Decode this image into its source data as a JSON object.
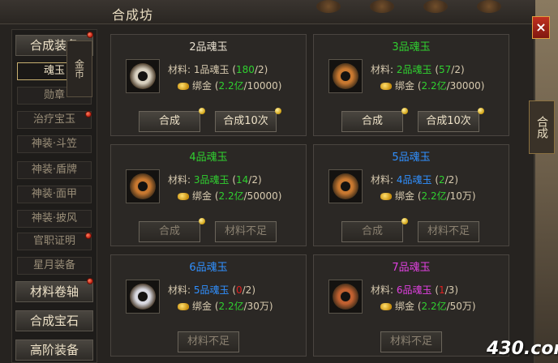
{
  "window": {
    "title": "合成坊"
  },
  "side_tabs": {
    "gold": "金币",
    "merge": "合成",
    "close": "×"
  },
  "sidebar": {
    "categories": [
      {
        "label": "合成装备"
      },
      {
        "label": "材料卷轴"
      },
      {
        "label": "合成宝石"
      },
      {
        "label": "高阶装备"
      }
    ],
    "items": [
      {
        "label": "魂玉"
      },
      {
        "label": "勋章"
      },
      {
        "label": "治疗宝玉"
      },
      {
        "label": "神装·斗笠"
      },
      {
        "label": "神装·盾牌"
      },
      {
        "label": "神装·面甲"
      },
      {
        "label": "神装·披风"
      },
      {
        "label": "官职证明"
      },
      {
        "label": "星月装备"
      }
    ]
  },
  "recipes": [
    {
      "title": "2品魂玉",
      "title_color": "#e8e0d0",
      "ring_color": "#d8d0c0",
      "mat_prefix": "材料: ",
      "mat_name": "1品魂玉",
      "mat_open": " (",
      "mat_have": "180",
      "mat_need": "/2)",
      "gold_label": "绑金 (",
      "gold_have": "2.2亿",
      "gold_cost": "/10000)",
      "buttons": [
        "合成",
        "合成10次"
      ]
    },
    {
      "title": "3品魂玉",
      "title_color": "#30d030",
      "ring_color": "#c87830",
      "mat_prefix": "材料: ",
      "mat_name": "2品魂玉",
      "mat_open": " (",
      "mat_have": "57",
      "mat_need": "/2)",
      "gold_label": "绑金 (",
      "gold_have": "2.2亿",
      "gold_cost": "/30000)",
      "buttons": [
        "合成",
        "合成10次"
      ]
    },
    {
      "title": "4品魂玉",
      "title_color": "#30d030",
      "ring_color": "#c87830",
      "mat_prefix": "材料: ",
      "mat_name": "3品魂玉",
      "mat_open": " (",
      "mat_have": "14",
      "mat_need": "/2)",
      "gold_label": "绑金 (",
      "gold_have": "2.2亿",
      "gold_cost": "/50000)",
      "buttons": [
        "合成",
        "材料不足"
      ]
    },
    {
      "title": "5品魂玉",
      "title_color": "#3090ff",
      "ring_color": "#c87830",
      "mat_prefix": "材料: ",
      "mat_name": "4品魂玉",
      "mat_open": " (",
      "mat_have": "2",
      "mat_need": "/2)",
      "gold_label": "绑金 (",
      "gold_have": "2.2亿",
      "gold_cost": "/10万)",
      "buttons": [
        "合成",
        "材料不足"
      ]
    },
    {
      "title": "6品魂玉",
      "title_color": "#3090ff",
      "ring_color": "#d8d8e0",
      "mat_prefix": "材料: ",
      "mat_name": "5品魂玉",
      "mat_open": " (",
      "mat_have": "0",
      "mat_need": "/2)",
      "gold_label": "绑金 (",
      "gold_have": "2.2亿",
      "gold_cost": "/30万)",
      "buttons": [
        "材料不足"
      ]
    },
    {
      "title": "7品魂玉",
      "title_color": "#e040e0",
      "ring_color": "#c06030",
      "mat_prefix": "材料: ",
      "mat_name": "6品魂玉",
      "mat_open": " (",
      "mat_have": "1",
      "mat_need": "/3)",
      "gold_label": "绑金 (",
      "gold_have": "2.2亿",
      "gold_cost": "/50万)",
      "buttons": [
        "材料不足"
      ]
    }
  ],
  "watermark": "430.com"
}
